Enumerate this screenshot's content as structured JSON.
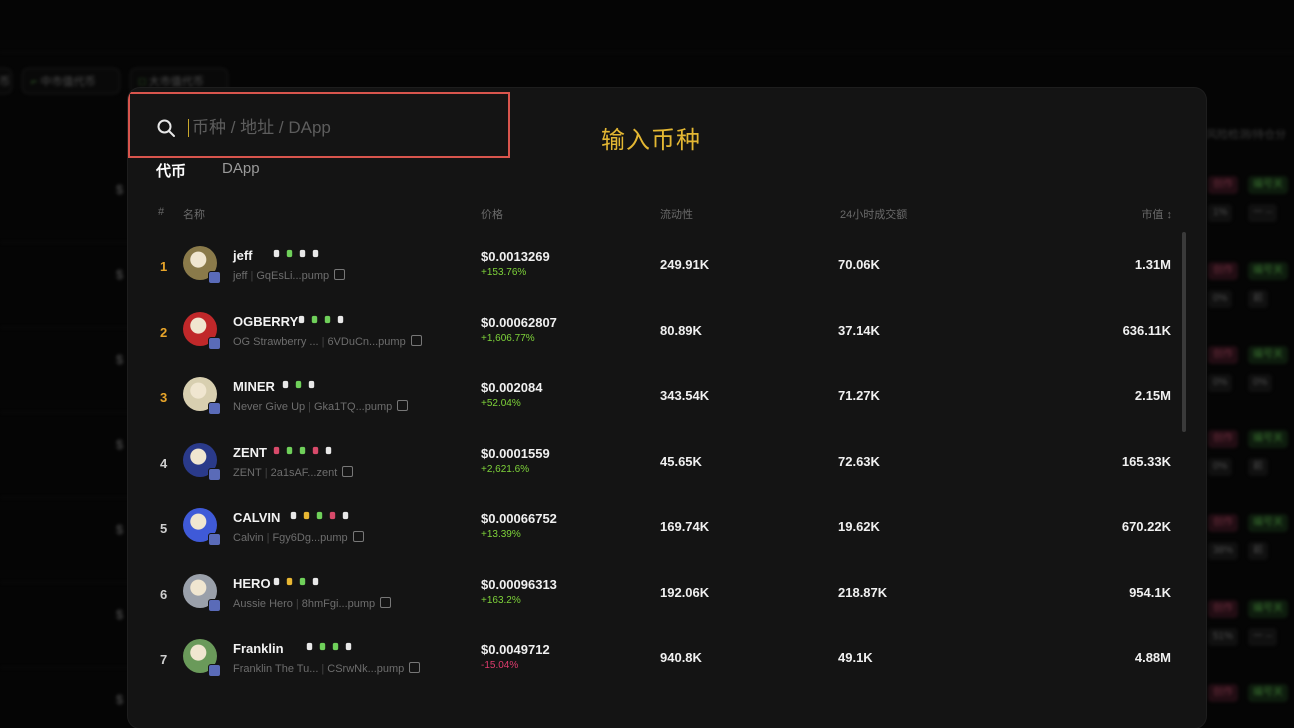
{
  "background": {
    "pills": [
      {
        "label": "币"
      },
      {
        "label": "中市值代币",
        "icon": "chart-icon"
      },
      {
        "label": "大市值代币",
        "icon": "box-icon"
      }
    ],
    "right_header": "风险检测/持仓分",
    "left_fragments": [
      "$",
      "$",
      "$",
      "$",
      "$",
      "$",
      "$"
    ],
    "right_tags": [
      {
        "text": "创作",
        "tone": "red"
      },
      {
        "text": "编号关",
        "tone": "green"
      },
      {
        "text": "1%",
        "tone": "dark"
      },
      {
        "text": "一 --",
        "tone": "dark"
      },
      {
        "text": "创作",
        "tone": "red"
      },
      {
        "text": "编号关",
        "tone": "green"
      },
      {
        "text": "0%",
        "tone": "dark"
      },
      {
        "text": "前",
        "tone": "dark"
      },
      {
        "text": "创作",
        "tone": "red"
      },
      {
        "text": "编号关",
        "tone": "green"
      },
      {
        "text": "0%",
        "tone": "dark"
      },
      {
        "text": "0%",
        "tone": "dark"
      },
      {
        "text": "创作",
        "tone": "red"
      },
      {
        "text": "编号关",
        "tone": "green"
      },
      {
        "text": "0%",
        "tone": "dark"
      },
      {
        "text": "前",
        "tone": "dark"
      },
      {
        "text": "创作",
        "tone": "red"
      },
      {
        "text": "编号关",
        "tone": "green"
      },
      {
        "text": "38%",
        "tone": "dark"
      },
      {
        "text": "前",
        "tone": "dark"
      },
      {
        "text": "创作",
        "tone": "red"
      },
      {
        "text": "编号关",
        "tone": "green"
      },
      {
        "text": "51%",
        "tone": "dark"
      },
      {
        "text": "一 --",
        "tone": "dark"
      },
      {
        "text": "创作",
        "tone": "red"
      },
      {
        "text": "编号关",
        "tone": "green"
      }
    ]
  },
  "search": {
    "placeholder": "币种 / 地址 / DApp",
    "value": ""
  },
  "annotation": "输入币种",
  "tabs": [
    {
      "label": "代币",
      "active": true
    },
    {
      "label": "DApp",
      "active": false
    }
  ],
  "table": {
    "headers": {
      "rank": "#",
      "name": "名称",
      "price": "价格",
      "liquidity": "流动性",
      "volume": "24小时成交额",
      "mcap": "市值 ↕"
    },
    "rows": [
      {
        "rank": "1",
        "symbol": "jeff",
        "name": "jeff",
        "address": "GqEsLi...pump",
        "price": "$0.0013269",
        "change": "+153.76%",
        "dir": "up",
        "liquidity": "249.91K",
        "volume": "70.06K",
        "mcap": "1.31M",
        "avatar_color": "#8a7a4a",
        "badges": [
          "#e8e8e8",
          "#6fd05a",
          "#e8e8e8",
          "#e8e8e8"
        ]
      },
      {
        "rank": "2",
        "symbol": "OGBERRY",
        "name": "OG Strawberry ...",
        "address": "6VDuCn...pump",
        "price": "$0.00062807",
        "change": "+1,606.77%",
        "dir": "up",
        "liquidity": "80.89K",
        "volume": "37.14K",
        "mcap": "636.11K",
        "avatar_color": "#c0282a",
        "badges": [
          "#e8e8e8",
          "#6fd05a",
          "#6fd05a",
          "#e8e8e8"
        ]
      },
      {
        "rank": "3",
        "symbol": "MINER",
        "name": "Never Give Up",
        "address": "Gka1TQ...pump",
        "price": "$0.002084",
        "change": "+52.04%",
        "dir": "up",
        "liquidity": "343.54K",
        "volume": "71.27K",
        "mcap": "2.15M",
        "avatar_color": "#d8cfb0",
        "badges": [
          "#e8e8e8",
          "#6fd05a",
          "#e8e8e8"
        ]
      },
      {
        "rank": "4",
        "symbol": "ZENT",
        "name": "ZENT",
        "address": "2a1sAF...zent",
        "price": "$0.0001559",
        "change": "+2,621.6%",
        "dir": "up",
        "liquidity": "45.65K",
        "volume": "72.63K",
        "mcap": "165.33K",
        "avatar_color": "#2a3a8a",
        "badges": [
          "#d84a6a",
          "#6fd05a",
          "#6fd05a",
          "#d84a6a",
          "#e8e8e8"
        ]
      },
      {
        "rank": "5",
        "symbol": "CALVIN",
        "name": "Calvin",
        "address": "Fgy6Dg...pump",
        "price": "$0.00066752",
        "change": "+13.39%",
        "dir": "up",
        "liquidity": "169.74K",
        "volume": "19.62K",
        "mcap": "670.22K",
        "avatar_color": "#3f5ad8",
        "badges": [
          "#e8e8e8",
          "#e8b733",
          "#6fd05a",
          "#d84a6a",
          "#e8e8e8"
        ]
      },
      {
        "rank": "6",
        "symbol": "HERO",
        "name": "Aussie Hero",
        "address": "8hmFgi...pump",
        "price": "$0.00096313",
        "change": "+163.2%",
        "dir": "up",
        "liquidity": "192.06K",
        "volume": "218.87K",
        "mcap": "954.1K",
        "avatar_color": "#9aa0aa",
        "badges": [
          "#e8e8e8",
          "#e8b733",
          "#6fd05a",
          "#e8e8e8"
        ]
      },
      {
        "rank": "7",
        "symbol": "Franklin",
        "name": "Franklin The Tu...",
        "address": "CSrwNk...pump",
        "price": "$0.0049712",
        "change": "-15.04%",
        "dir": "down",
        "liquidity": "940.8K",
        "volume": "49.1K",
        "mcap": "4.88M",
        "avatar_color": "#6a9a5a",
        "badges": [
          "#e8e8e8",
          "#6fd05a",
          "#6fd05a",
          "#e8e8e8"
        ]
      }
    ]
  },
  "colors": {
    "rank_top": "#e8a52a",
    "rank_default": "#cfcfcf",
    "up": "#7ed33a",
    "down": "#e03c6e",
    "search_border": "#d8554d",
    "annotation": "#e3b733"
  }
}
